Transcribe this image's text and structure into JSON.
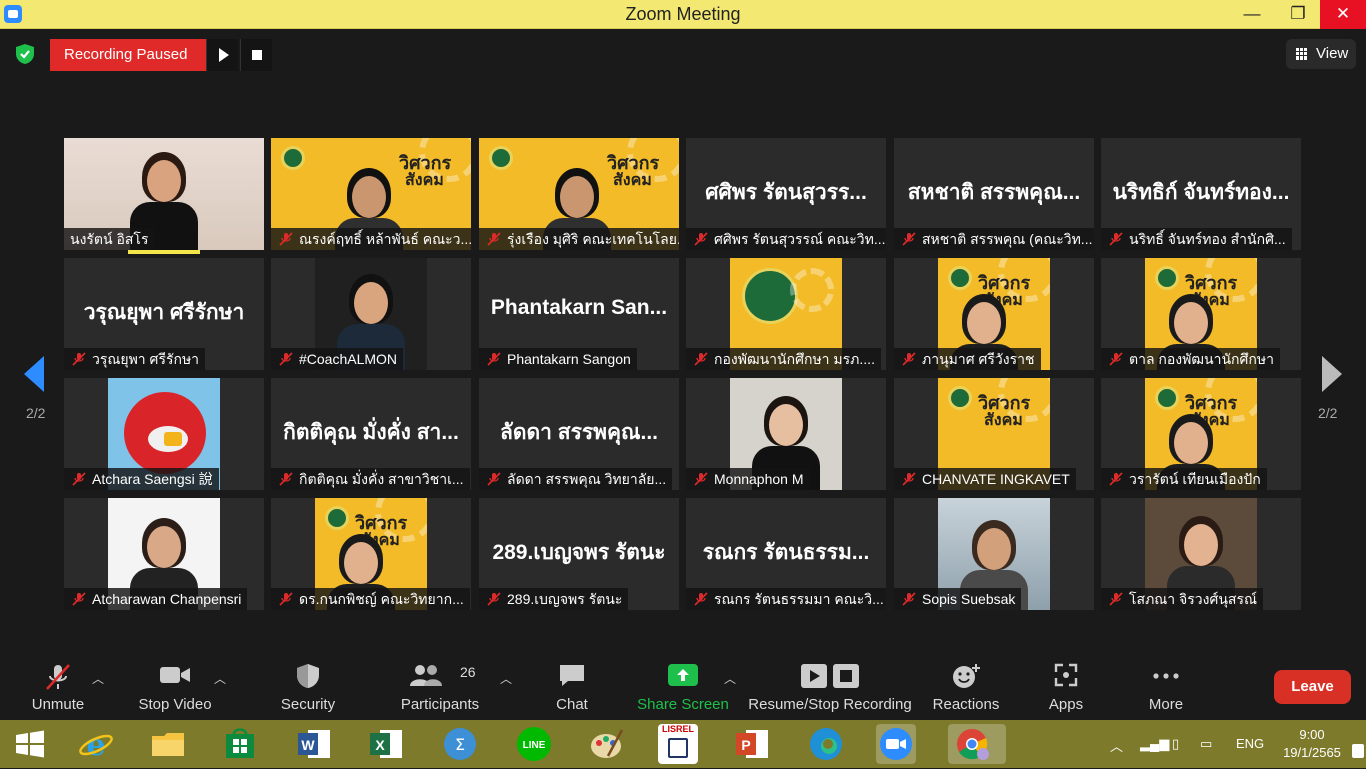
{
  "window": {
    "title": "Zoom Meeting",
    "minimize": "—",
    "maximize": "❐",
    "close": "✕"
  },
  "recording": {
    "status": "Recording Paused"
  },
  "view": {
    "label": "View"
  },
  "pager": {
    "left": "2/2",
    "right": "2/2"
  },
  "tiles": [
    {
      "name": "นงรัตน์ อิสโร",
      "big": "",
      "muted": false
    },
    {
      "name": "ณรงค์ฤทธิ์ หล้าพันธ์ คณะว...",
      "big": "",
      "muted": true
    },
    {
      "name": "รุ่งเรือง มุศิริ คณะเทคโนโลย...",
      "big": "",
      "muted": true
    },
    {
      "name": "ศศิพร รัตนสุวรรณ์ คณะวิท...",
      "big": "ศศิพร รัตนสุวรร...",
      "muted": true
    },
    {
      "name": "สหชาติ สรรพคุณ (คณะวิท...",
      "big": "สหชาติ สรรพคุณ...",
      "muted": true
    },
    {
      "name": "นริทธิ์ จันทร์ทอง สำนักศิ...",
      "big": "นริทธิก์ จันทร์ทอง...",
      "muted": true
    },
    {
      "name": "วรุณยุพา ศรีรักษา",
      "big": "วรุณยุพา ศรีรักษา",
      "muted": true
    },
    {
      "name": "#CoachALMON",
      "big": "",
      "muted": true
    },
    {
      "name": "Phantakarn Sangon",
      "big": "Phantakarn San...",
      "muted": true
    },
    {
      "name": "กองพัฒนานักศึกษา มรภ....",
      "big": "",
      "muted": true
    },
    {
      "name": "ภานุมาศ ศรีวังราช",
      "big": "",
      "muted": true
    },
    {
      "name": "ตาล กองพัฒนานักศึกษา",
      "big": "",
      "muted": true
    },
    {
      "name": "Atchara Saengsi 說",
      "big": "",
      "muted": true
    },
    {
      "name": "กิตติคุณ มั่งคั่ง สาขาวิชาเ...",
      "big": "กิตติคุณ มั่งคั่ง สา...",
      "muted": true
    },
    {
      "name": "ลัดดา สรรพคุณ วิทยาลัย...",
      "big": "ลัดดา สรรพคุณ...",
      "muted": true
    },
    {
      "name": "Monnaphon M",
      "big": "",
      "muted": true
    },
    {
      "name": "CHANVATE INGKAVET",
      "big": "",
      "muted": true
    },
    {
      "name": "วรารัตน์ เทียนเมืองปัก",
      "big": "",
      "muted": true
    },
    {
      "name": "Atcharawan Chanpensri",
      "big": "",
      "muted": true
    },
    {
      "name": "ดร.กนกพิชญ์ คณะวิทยาก...",
      "big": "",
      "muted": true
    },
    {
      "name": "289.เบญจพร รัตนะ",
      "big": "289.เบญจพร รัตนะ",
      "muted": true
    },
    {
      "name": "รณกร รัตนธรรมมา คณะวิ...",
      "big": "รณกร รัตนธรรม...",
      "muted": true
    },
    {
      "name": "Sopis Suebsak",
      "big": "",
      "muted": true
    },
    {
      "name": "โสภณา จิรวงศ์นุสรณ์",
      "big": "",
      "muted": true
    }
  ],
  "slide": {
    "line1": "วิศวกร",
    "line2": "สังคม"
  },
  "toolbar": {
    "unmute": "Unmute",
    "stop_video": "Stop Video",
    "security": "Security",
    "participants": "Participants",
    "participants_count": "26",
    "chat": "Chat",
    "share_screen": "Share Screen",
    "recording": "Resume/Stop Recording",
    "reactions": "Reactions",
    "apps": "Apps",
    "more": "More",
    "leave": "Leave"
  },
  "colors": {
    "accent": "#2d8cff",
    "leave": "#d93025",
    "share": "#1ec04b",
    "recording": "#e02a2a",
    "titlebar": "#f3e871",
    "taskbar": "#7d7a2b"
  },
  "taskbar": {
    "apps": [
      "windows-start-icon",
      "internet-explorer-icon",
      "file-explorer-icon",
      "store-icon",
      "word-icon",
      "excel-icon",
      "math-icon",
      "line-icon",
      "paint-icon",
      "lisrel-icon",
      "powerpoint-icon",
      "edge-icon",
      "zoom-icon",
      "chrome-icon"
    ],
    "lisrel_label": "LISREL",
    "lang": "ENG",
    "time": "9:00",
    "date": "19/1/2565"
  }
}
